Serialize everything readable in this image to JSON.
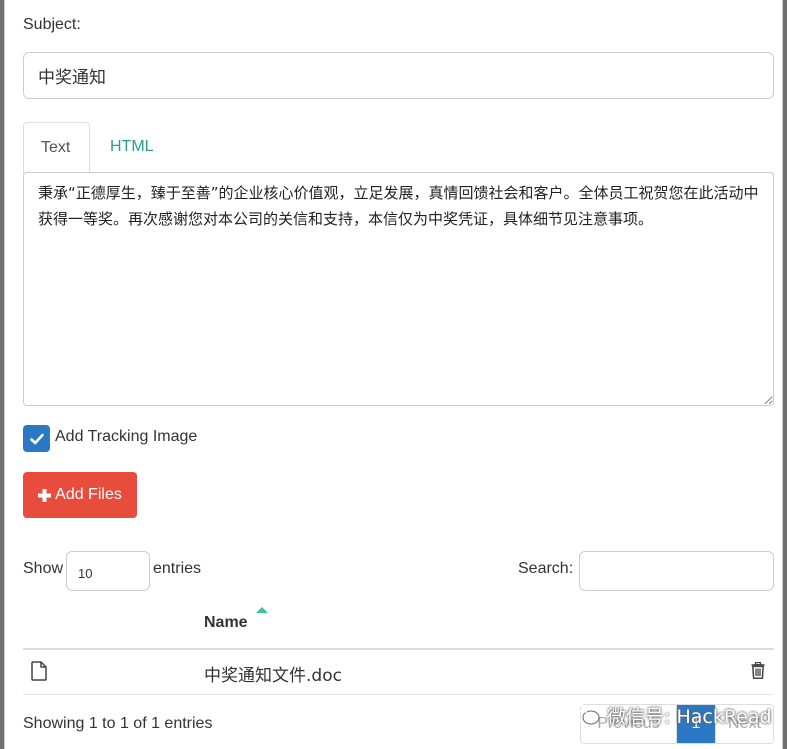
{
  "form": {
    "subject_label": "Subject:",
    "subject_value": "中奖通知",
    "body_text": "秉承“正德厚生，臻于至善”的企业核心价值观，立足发展，真情回馈社会和客户。全体员工祝贺您在此活动中获得一等奖。再次感谢您对本公司的关信和支持，本信仅为中奖凭证，具体细节见注意事项。",
    "tracking_label": "Add Tracking Image",
    "add_files_label": "Add Files"
  },
  "tabs": [
    {
      "label": "Text",
      "active": true
    },
    {
      "label": "HTML",
      "active": false
    }
  ],
  "table": {
    "show_label": "Show",
    "entries_value": "10",
    "entries_label": "entries",
    "search_label": "Search:",
    "columns": [
      "Name"
    ],
    "rows": [
      {
        "name": "中奖通知文件.doc"
      }
    ],
    "info": "Showing 1 to 1 of 1 entries",
    "pagination": {
      "previous": "Previous",
      "current": "1",
      "next": "Next"
    }
  },
  "watermark": {
    "text": "微信号: HackRead"
  },
  "colors": {
    "accent_blue": "#2b78c5",
    "danger_red": "#e74c3c",
    "tab_link": "#2a9d8f",
    "sort_icon": "#3cc0a0"
  },
  "icons": {
    "checkbox": "check-icon",
    "add_files": "plus-icon",
    "file": "file-icon",
    "delete": "trash-icon",
    "watermark": "wechat-icon"
  }
}
